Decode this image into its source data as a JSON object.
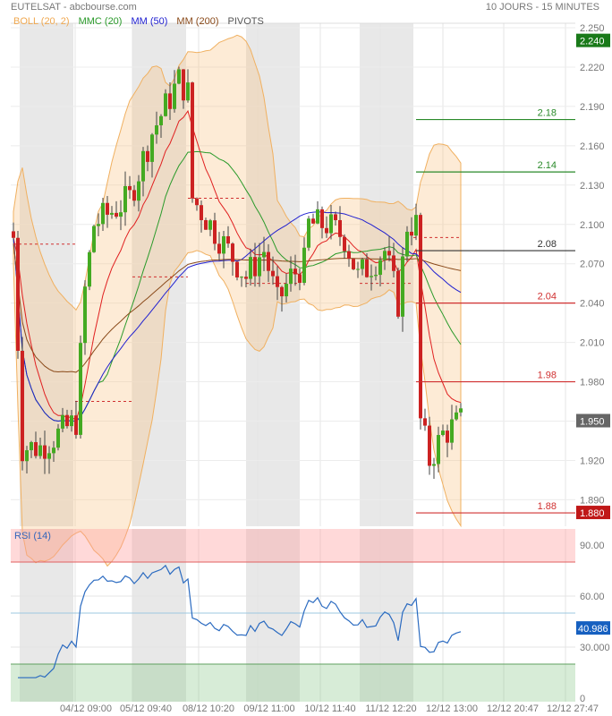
{
  "header": {
    "title": "EUTELSAT - abcbourse.com",
    "period": "10 JOURS - 15 MINUTES"
  },
  "legend": [
    {
      "label": "BOLL (20, 2)",
      "color": "#f0a850"
    },
    {
      "label": "MMC (20)",
      "color": "#2a9a2a"
    },
    {
      "label": "MM (50)",
      "color": "#2020d0"
    },
    {
      "label": "MM (200)",
      "color": "#8a4a1a"
    },
    {
      "label": "PIVOTS",
      "color": "#555555"
    }
  ],
  "chart_data": [
    {
      "type": "candlestick",
      "title": "EUTELSAT",
      "ylim": [
        1.87,
        2.26
      ],
      "y_ticks": [
        "2.250",
        "2.220",
        "2.190",
        "2.160",
        "2.130",
        "2.100",
        "2.070",
        "2.040",
        "2.010",
        "1.980",
        "1.950",
        "1.920",
        "1.890"
      ],
      "x_ticks": [
        "04/12 09:00",
        "05/12 09:40",
        "08/12 10:20",
        "09/12 11:00",
        "10/12 11:40",
        "11/12 12:20",
        "12/12 13:00",
        "12/12 20:47",
        "12/12 27:47"
      ],
      "approx_close_keypoints": [
        [
          0,
          2.09
        ],
        [
          2,
          1.93
        ],
        [
          6,
          1.93
        ],
        [
          10,
          1.94
        ],
        [
          14,
          1.95
        ],
        [
          16,
          2.05
        ],
        [
          18,
          2.1
        ],
        [
          22,
          2.11
        ],
        [
          26,
          2.12
        ],
        [
          28,
          2.14
        ],
        [
          31,
          2.17
        ],
        [
          34,
          2.19
        ],
        [
          37,
          2.21
        ],
        [
          39,
          2.2
        ],
        [
          40,
          2.12
        ],
        [
          44,
          2.1
        ],
        [
          48,
          2.08
        ],
        [
          52,
          2.06
        ],
        [
          56,
          2.08
        ],
        [
          59,
          2.04
        ],
        [
          62,
          2.06
        ],
        [
          65,
          2.07
        ],
        [
          66,
          2.1
        ],
        [
          70,
          2.1
        ],
        [
          74,
          2.09
        ],
        [
          77,
          2.06
        ],
        [
          80,
          2.07
        ],
        [
          83,
          2.08
        ],
        [
          86,
          2.04
        ],
        [
          88,
          2.1
        ],
        [
          90,
          2.1
        ],
        [
          91,
          1.95
        ],
        [
          93,
          1.92
        ],
        [
          96,
          1.94
        ],
        [
          100,
          1.95
        ]
      ],
      "last_price": "1.950",
      "high_marker": "2.240",
      "low_marker": "1.880",
      "pivots": [
        {
          "label": "2.18",
          "value": 2.18,
          "color": "#2a8a2a"
        },
        {
          "label": "2.14",
          "value": 2.14,
          "color": "#2a8a2a"
        },
        {
          "label": "2.08",
          "value": 2.08,
          "color": "#333333"
        },
        {
          "label": "2.04",
          "value": 2.04,
          "color": "#d03030"
        },
        {
          "label": "1.98",
          "value": 1.98,
          "color": "#d03030"
        },
        {
          "label": "1.88",
          "value": 1.88,
          "color": "#d03030"
        }
      ]
    },
    {
      "type": "line",
      "title": "RSI (14)",
      "ylim": [
        0,
        100
      ],
      "y_ticks": [
        "90.00",
        "60.00",
        "30.000",
        "0"
      ],
      "overbought": 80,
      "oversold": 20,
      "mid": 50,
      "last_value": "40.986"
    }
  ]
}
